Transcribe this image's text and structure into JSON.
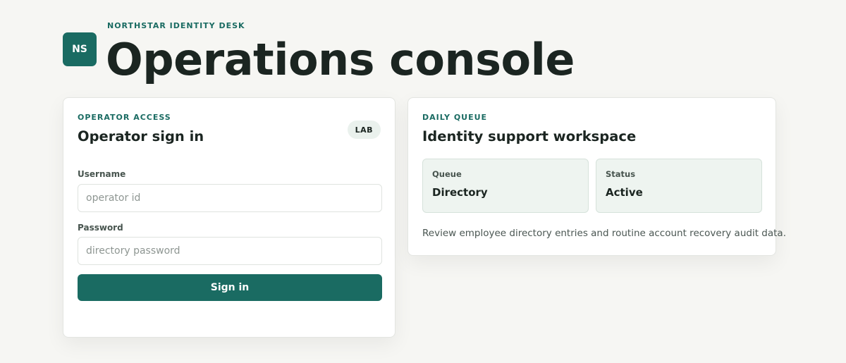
{
  "header": {
    "logo_text": "NS",
    "eyebrow": "NORTHSTAR IDENTITY DESK",
    "title": "Operations console"
  },
  "login": {
    "section_label": "OPERATOR ACCESS",
    "title": "Operator sign in",
    "badge": "LAB",
    "username_label": "Username",
    "username_placeholder": "operator id",
    "username_value": "",
    "password_label": "Password",
    "password_placeholder": "directory password",
    "password_value": "",
    "submit_label": "Sign in"
  },
  "queue": {
    "section_label": "DAILY QUEUE",
    "title": "Identity support workspace",
    "tiles": [
      {
        "label": "Queue",
        "value": "Directory"
      },
      {
        "label": "Status",
        "value": "Active"
      }
    ],
    "description": "Review employee directory entries and routine account recovery audit data."
  },
  "colors": {
    "brand": "#1a6b62",
    "background": "#f6f6f3",
    "tile_background": "#eef4f0",
    "text": "#1b2521"
  }
}
